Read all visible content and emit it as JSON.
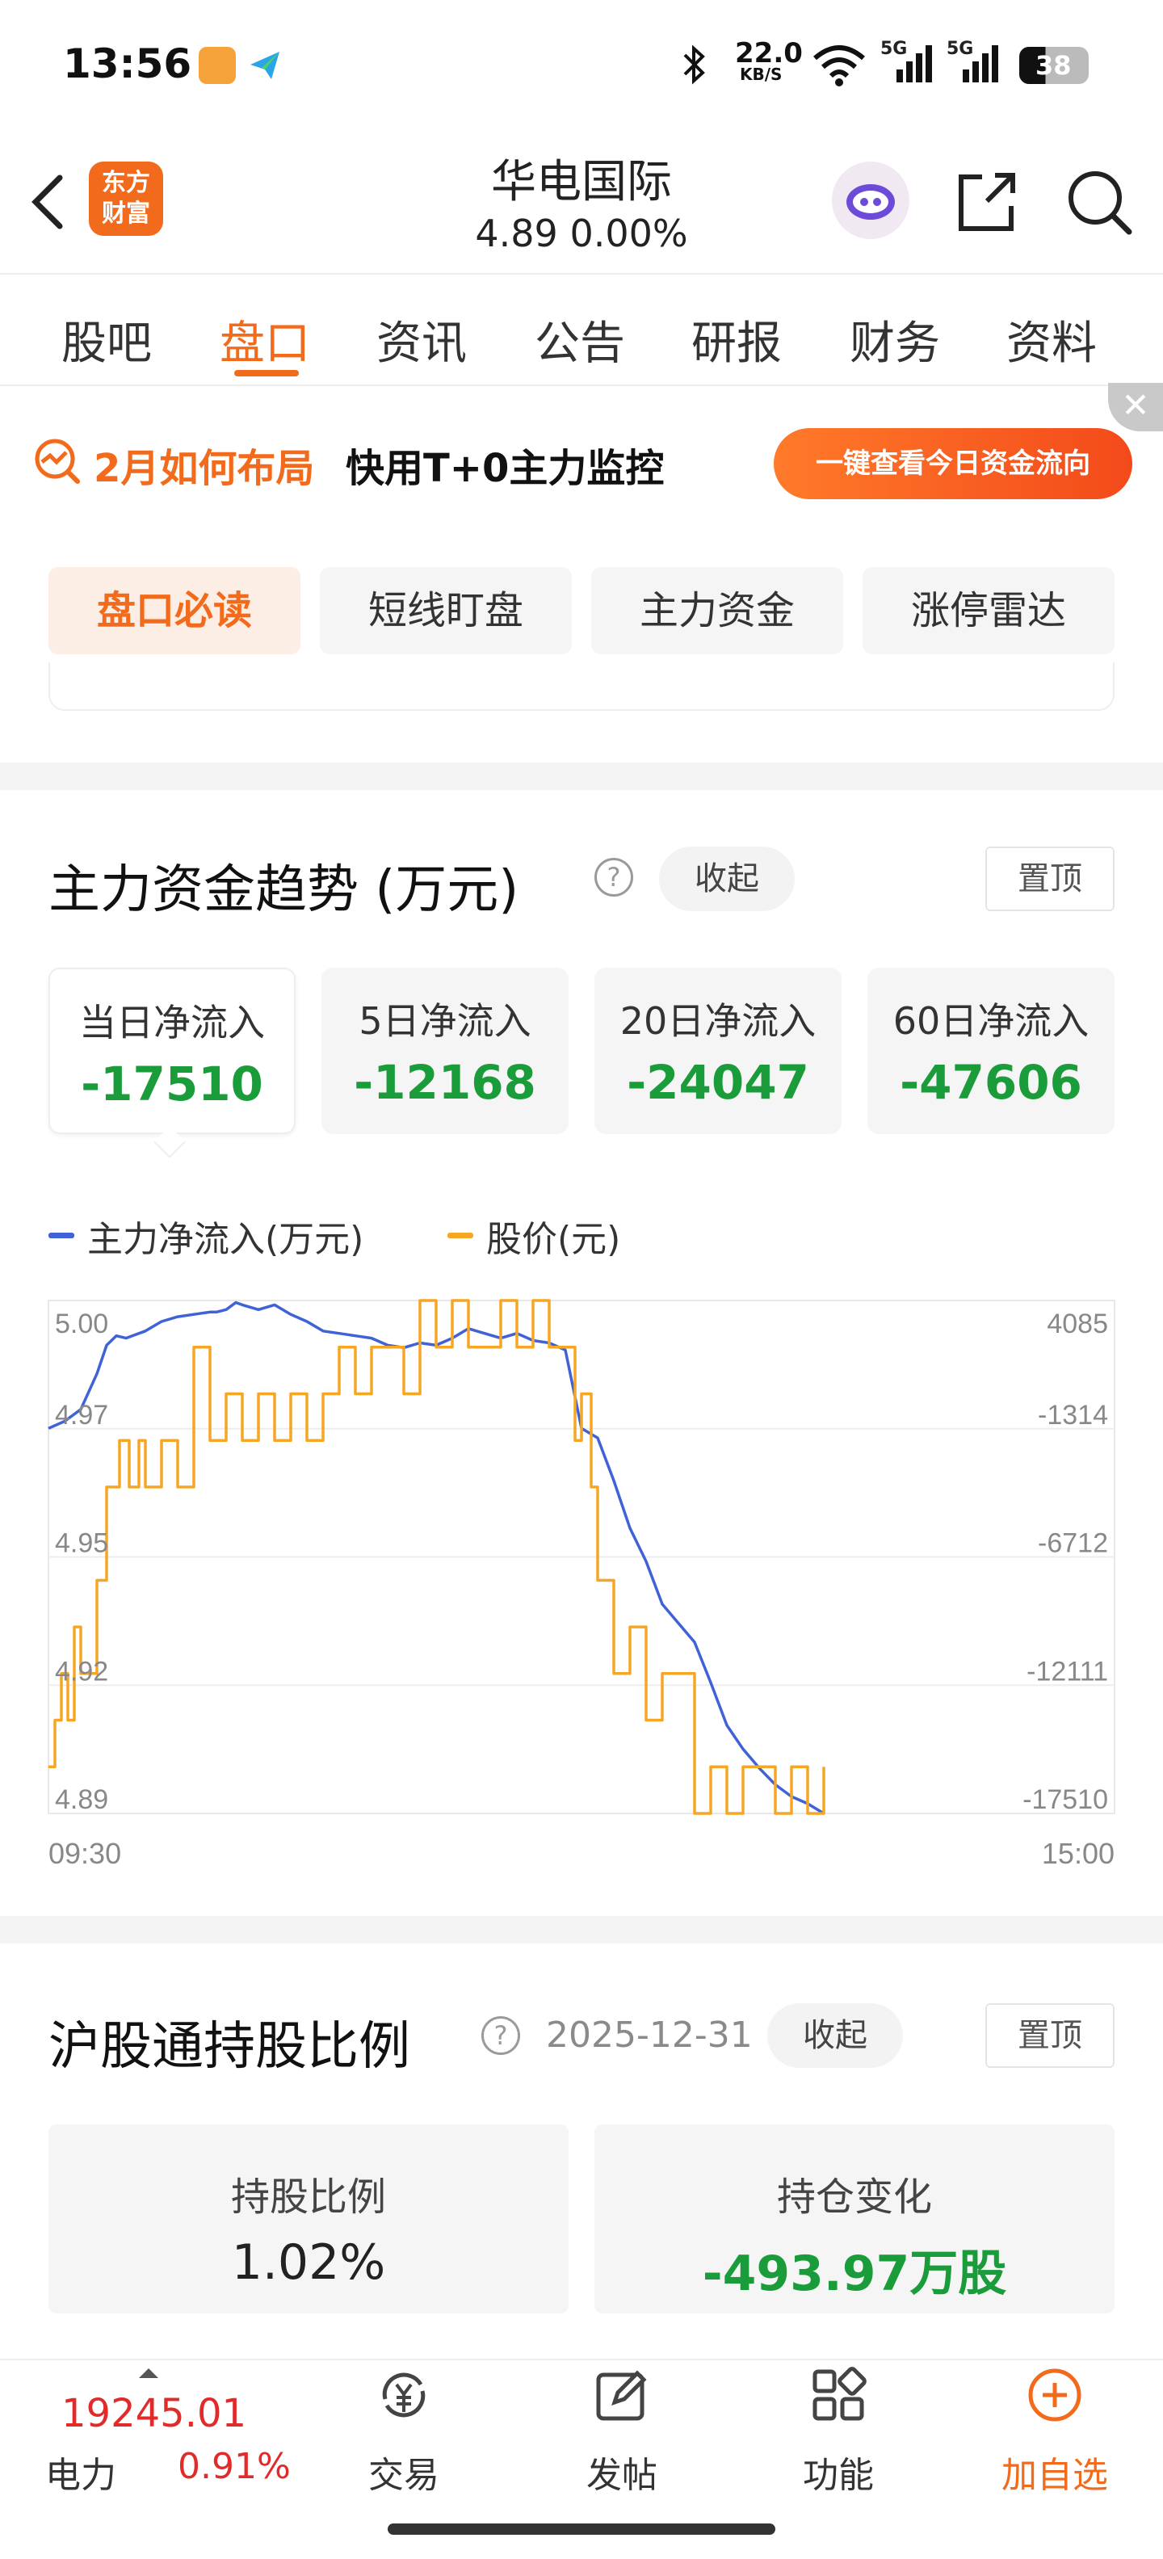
{
  "status_bar": {
    "time": "13:56",
    "net_speed": "22.0",
    "net_unit": "KB/S",
    "battery": "38",
    "network_badge_1": "5G",
    "network_badge_2": "5G"
  },
  "header": {
    "logo_line1": "东方",
    "logo_line2": "财富",
    "stock_name": "华电国际",
    "price_line": "4.89   0.00%",
    "icons": [
      "back-icon",
      "robot-avatar",
      "share-icon",
      "search-icon"
    ]
  },
  "tabs": [
    {
      "label": "股吧"
    },
    {
      "label": "盘口"
    },
    {
      "label": "资讯"
    },
    {
      "label": "公告"
    },
    {
      "label": "研报"
    },
    {
      "label": "财务"
    },
    {
      "label": "资料"
    }
  ],
  "promo": {
    "title": "2月如何布局",
    "subtitle": "快用T+0主力监控",
    "button": "一键查看今日资金流向",
    "close": "✕"
  },
  "sub_tabs": [
    {
      "label": "盘口必读"
    },
    {
      "label": "短线盯盘"
    },
    {
      "label": "主力资金"
    },
    {
      "label": "涨停雷达"
    }
  ],
  "flow_section": {
    "title": "主力资金趋势 (万元)",
    "help": "?",
    "collapse": "收起",
    "pin": "置顶",
    "cards": [
      {
        "label": "当日净流入",
        "value": "-17510"
      },
      {
        "label": "5日净流入",
        "value": "-12168"
      },
      {
        "label": "20日净流入",
        "value": "-24047"
      },
      {
        "label": "60日净流入",
        "value": "-47606"
      }
    ],
    "legend": [
      {
        "label": "主力净流入(万元)",
        "color": "#3f63d6"
      },
      {
        "label": "股价(元)",
        "color": "#f5a623"
      }
    ]
  },
  "chart_data": {
    "type": "line",
    "x_ticks": [
      "09:30",
      "15:00"
    ],
    "y_left_ticks": [
      "5.00",
      "4.97",
      "4.95",
      "4.92",
      "4.89"
    ],
    "y_right_ticks": [
      "4085",
      "-1314",
      "-6712",
      "-12111",
      "-17510"
    ],
    "y_left_lim": [
      4.89,
      5.0
    ],
    "y_right_lim": [
      -17510,
      4085
    ],
    "grid": true,
    "series": [
      {
        "name": "主力净流入(万元)",
        "color": "#3f63d6",
        "axis": "right",
        "x_minutes": [
          0,
          5,
          10,
          15,
          18,
          21,
          24,
          30,
          35,
          40,
          45,
          50,
          52,
          55,
          58,
          60,
          65,
          70,
          75,
          80,
          85,
          90,
          95,
          100,
          105,
          110,
          115,
          120,
          125,
          130,
          135,
          140,
          145,
          150,
          155,
          160,
          165,
          170,
          175,
          180,
          185,
          190,
          195,
          200,
          205,
          210,
          215,
          220,
          225,
          230,
          235,
          240
        ],
        "values": [
          -1300,
          -1000,
          -500,
          1000,
          2200,
          2600,
          2500,
          2800,
          3200,
          3400,
          3500,
          3600,
          3600,
          3700,
          4000,
          3900,
          3700,
          3900,
          3500,
          3200,
          2800,
          2700,
          2600,
          2500,
          2200,
          2100,
          2300,
          2200,
          2500,
          2900,
          2700,
          2500,
          2700,
          2400,
          2300,
          2000,
          -1300,
          -1700,
          -3500,
          -5500,
          -6900,
          -8700,
          -9500,
          -10300,
          -12000,
          -13800,
          -14800,
          -15600,
          -16300,
          -16800,
          -17100,
          -17510
        ]
      },
      {
        "name": "股价(元)",
        "color": "#f5a623",
        "axis": "left",
        "x_minutes": [
          0,
          2,
          4,
          6,
          8,
          10,
          12,
          15,
          18,
          20,
          22,
          25,
          28,
          30,
          35,
          40,
          45,
          50,
          55,
          60,
          65,
          70,
          75,
          80,
          85,
          90,
          95,
          100,
          105,
          110,
          115,
          120,
          125,
          130,
          135,
          140,
          145,
          150,
          155,
          160,
          163,
          165,
          168,
          170,
          175,
          180,
          185,
          190,
          195,
          200,
          205,
          210,
          215,
          220,
          225,
          230,
          235,
          240
        ],
        "values": [
          4.9,
          4.91,
          4.92,
          4.91,
          4.93,
          4.92,
          4.92,
          4.94,
          4.96,
          4.96,
          4.97,
          4.96,
          4.97,
          4.96,
          4.97,
          4.96,
          4.99,
          4.97,
          4.98,
          4.97,
          4.98,
          4.97,
          4.98,
          4.97,
          4.98,
          4.99,
          4.98,
          4.99,
          4.99,
          4.98,
          5.0,
          4.99,
          5.0,
          4.99,
          4.99,
          5.0,
          4.99,
          5.0,
          4.99,
          4.99,
          4.97,
          4.98,
          4.96,
          4.94,
          4.92,
          4.93,
          4.91,
          4.92,
          4.92,
          4.89,
          4.9,
          4.89,
          4.9,
          4.9,
          4.89,
          4.9,
          4.89,
          4.9
        ]
      }
    ],
    "x_total_minutes": 330
  },
  "hk_section": {
    "title": "沪股通持股比例",
    "help": "?",
    "date": "2025-12-31",
    "collapse": "收起",
    "pin": "置顶",
    "cards": [
      {
        "label": "持股比例",
        "value": "1.02%"
      },
      {
        "label": "持仓变化",
        "value": "-493.97万股"
      }
    ]
  },
  "bottom_bar": {
    "index_value": "19245.01",
    "index_name": "电力",
    "index_pct": "0.91%",
    "nav": [
      {
        "label": "交易",
        "icon": "yuan-cycle-icon"
      },
      {
        "label": "发帖",
        "icon": "edit-icon"
      },
      {
        "label": "功能",
        "icon": "grid-icon"
      },
      {
        "label": "加自选",
        "icon": "add-circle-icon"
      }
    ]
  }
}
